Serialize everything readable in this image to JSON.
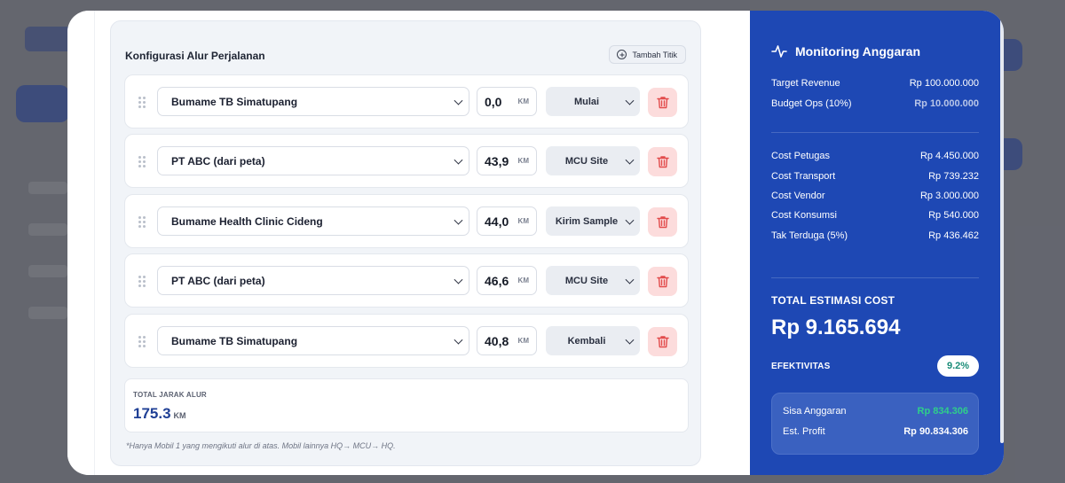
{
  "route_config": {
    "title": "Konfigurasi Alur Perjalanan",
    "add_button": "Tambah Titik",
    "km_unit": "KM",
    "rows": [
      {
        "location": "Bumame TB Simatupang",
        "km": "0,0",
        "type": "Mulai"
      },
      {
        "location": "PT ABC (dari peta)",
        "km": "43,9",
        "type": "MCU Site"
      },
      {
        "location": "Bumame Health Clinic Cideng",
        "km": "44,0",
        "type": "Kirim Sample"
      },
      {
        "location": "PT ABC (dari peta)",
        "km": "46,6",
        "type": "MCU Site"
      },
      {
        "location": "Bumame TB Simatupang",
        "km": "40,8",
        "type": "Kembali"
      }
    ],
    "total_label": "TOTAL JARAK ALUR",
    "total_value": "175.3",
    "total_unit": "KM",
    "footnote": "*Hanya Mobil 1 yang mengikuti alur di atas. Mobil lainnya HQ→ MCU→ HQ."
  },
  "monitoring": {
    "title": "Monitoring Anggaran",
    "icon": "activity-pulse-icon",
    "target_revenue_label": "Target Revenue",
    "target_revenue_value": "Rp 100.000.000",
    "budget_ops_label": "Budget Ops (10%)",
    "budget_ops_value": "Rp 10.000.000",
    "costs": [
      {
        "label": "Cost Petugas",
        "value": "Rp 4.450.000"
      },
      {
        "label": "Cost Transport",
        "value": "Rp 739.232"
      },
      {
        "label": "Cost Vendor",
        "value": "Rp 3.000.000"
      },
      {
        "label": "Cost Konsumsi",
        "value": "Rp 540.000"
      },
      {
        "label": "Tak Terduga (5%)",
        "value": "Rp 436.462"
      }
    ],
    "total_cost_label": "TOTAL ESTIMASI COST",
    "total_cost_value": "Rp 9.165.694",
    "effectivity_label": "EFEKTIVITAS",
    "effectivity_value": "9.2%",
    "sisa_label": "Sisa Anggaran",
    "sisa_value": "Rp 834.306",
    "profit_label": "Est. Profit",
    "profit_value": "Rp 90.834.306"
  },
  "colors": {
    "panel_blue": "#1e48b4",
    "title_blue": "#1f3f95",
    "delete_bg": "#fcdcdc",
    "delete_icon": "#e24b4b",
    "positive_green": "#2fcf8a"
  }
}
